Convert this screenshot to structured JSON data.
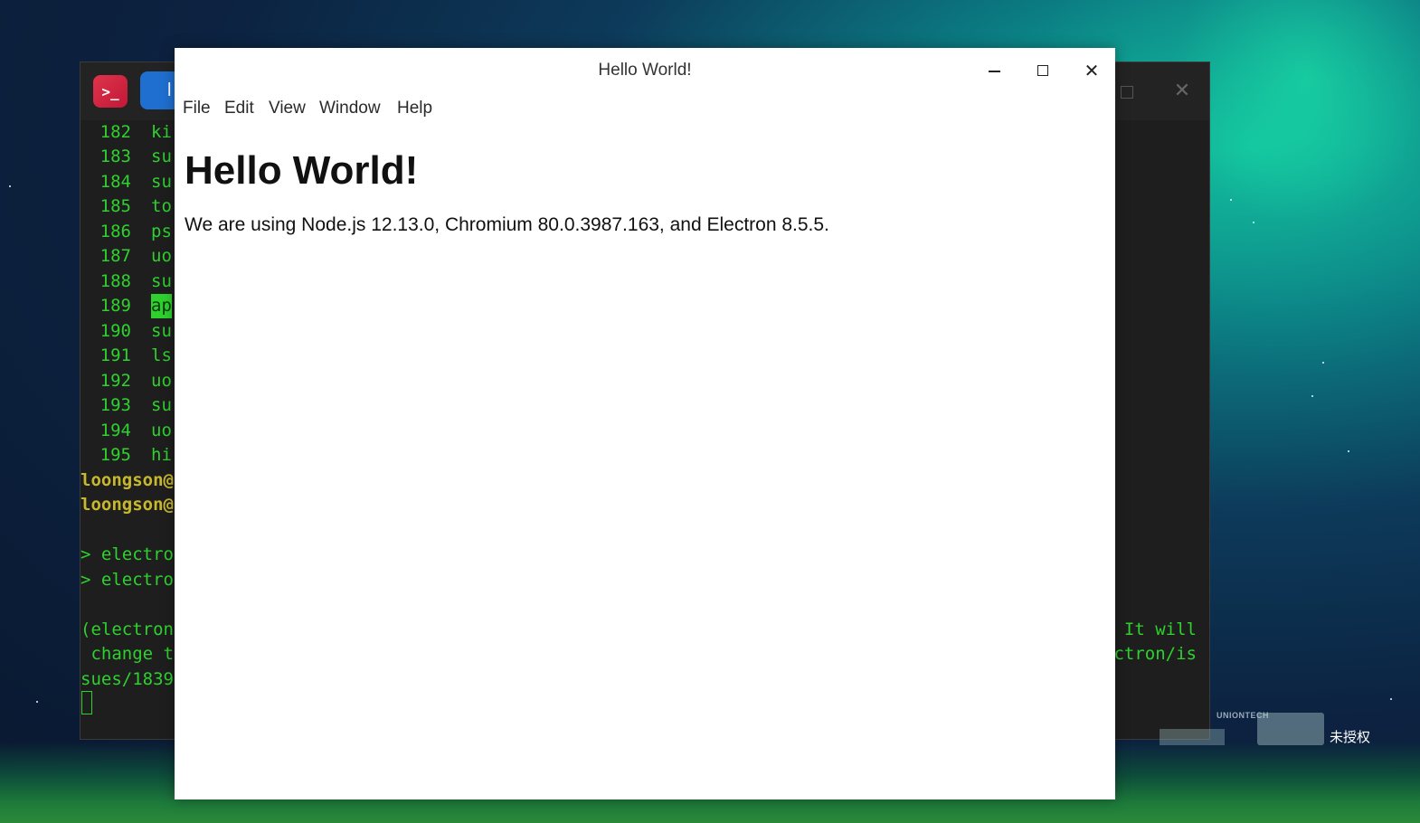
{
  "desktop": {
    "watermark_brand": "UNIONTECH",
    "watermark_text": "未授权"
  },
  "terminal": {
    "app_icon": ">_",
    "tab_label": "l",
    "history": [
      {
        "num": "182",
        "cmd": "ki"
      },
      {
        "num": "183",
        "cmd": "su"
      },
      {
        "num": "184",
        "cmd": "su"
      },
      {
        "num": "185",
        "cmd": "to"
      },
      {
        "num": "186",
        "cmd": "ps"
      },
      {
        "num": "187",
        "cmd": "uo"
      },
      {
        "num": "188",
        "cmd": "su"
      },
      {
        "num": "189",
        "cmd": "ap"
      },
      {
        "num": "190",
        "cmd": "su"
      },
      {
        "num": "191",
        "cmd": "ls"
      },
      {
        "num": "192",
        "cmd": "uo"
      },
      {
        "num": "193",
        "cmd": "su"
      },
      {
        "num": "194",
        "cmd": "uo"
      },
      {
        "num": "195",
        "cmd": "hi"
      }
    ],
    "prompt1": "loongson@",
    "prompt2": "loongson@",
    "output1": "> electron",
    "output2": "> electron",
    "warn_left1": "(electron",
    "warn_left2": " change t",
    "warn_left3": "sues/1839",
    "warn_right1": "It will",
    "warn_right2": "ctron/is",
    "colors": {
      "text": "#2ed12e",
      "prompt": "#c8b82e",
      "background": "#1e1e1e"
    }
  },
  "app": {
    "window_title": "Hello World!",
    "menu": [
      "File",
      "Edit",
      "View",
      "Window",
      "Help"
    ],
    "heading": "Hello World!",
    "paragraph": "We are using Node.js 12.13.0, Chromium 80.0.3987.163, and Electron 8.5.5."
  }
}
